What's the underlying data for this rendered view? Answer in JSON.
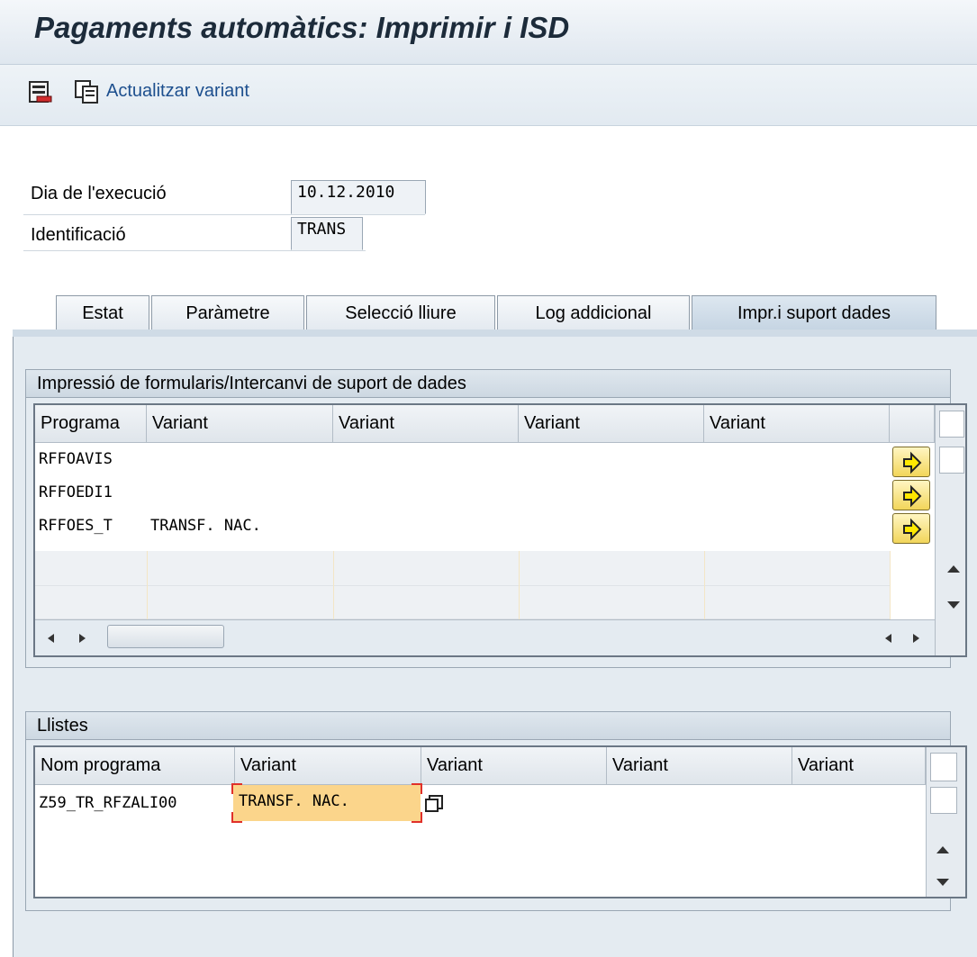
{
  "window": {
    "title": "Pagaments automàtics: Imprimir i ISD"
  },
  "toolbar": {
    "update_variant_label": "Actualitzar variant",
    "save_icon": "save-variant-icon",
    "copy_icon": "copy-variant-icon"
  },
  "header": {
    "execution_day_label": "Dia de l'execució",
    "execution_day_value": "10.12.2010",
    "identification_label": "Identificació",
    "identification_value": "TRANS"
  },
  "tabs": [
    {
      "label": "Estat",
      "active": false
    },
    {
      "label": "Paràmetre",
      "active": false
    },
    {
      "label": "Selecció lliure",
      "active": false
    },
    {
      "label": "Log addicional",
      "active": false
    },
    {
      "label": "Impr.i suport dades",
      "active": true
    }
  ],
  "forms_group": {
    "title": "Impressió de formularis/Intercanvi de suport de dades",
    "columns": [
      "Programa",
      "Variant",
      "Variant",
      "Variant",
      "Variant"
    ],
    "rows": [
      {
        "program": "RFFOAVIS",
        "variant1": ""
      },
      {
        "program": "RFFOEDI1",
        "variant1": ""
      },
      {
        "program": "RFFOES_T",
        "variant1": "TRANSF. NAC."
      }
    ]
  },
  "lists_group": {
    "title": "Llistes",
    "columns": [
      "Nom programa",
      "Variant",
      "Variant",
      "Variant",
      "Variant"
    ],
    "rows": [
      {
        "program": "Z59_TR_RFZALI00",
        "variant1": "TRANSF. NAC."
      }
    ]
  },
  "colors": {
    "accent_yellow": "#f2d65a",
    "highlight_orange": "#fbd58b",
    "focus_red": "#e0302a"
  }
}
